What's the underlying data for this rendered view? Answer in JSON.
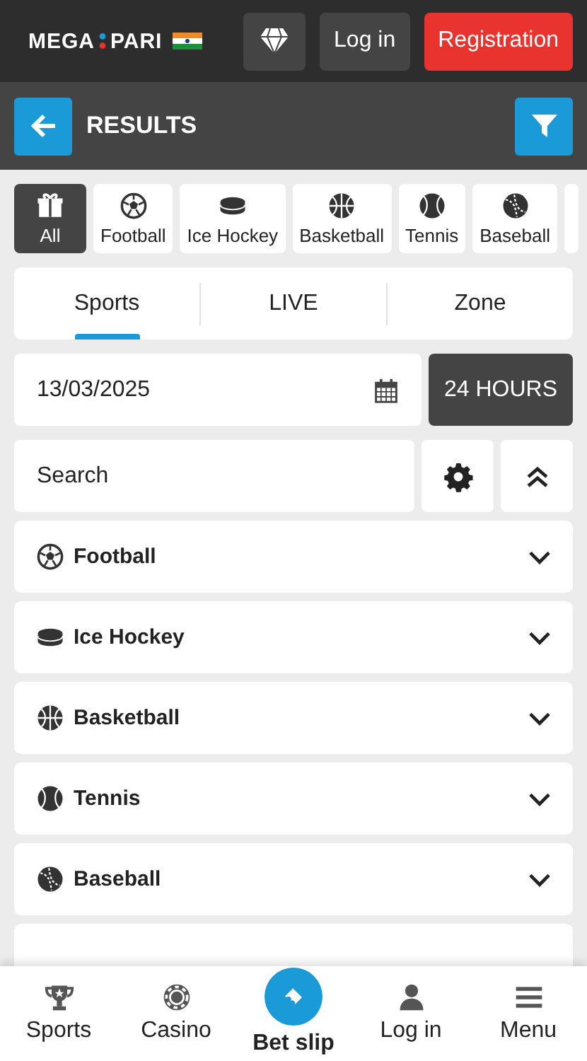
{
  "header": {
    "logo": {
      "left": "MEGA",
      "right": "PARI"
    },
    "login": "Log in",
    "register": "Registration"
  },
  "title": "RESULTS",
  "sport_chips": [
    {
      "label": "All",
      "kind": "gift",
      "selected": true
    },
    {
      "label": "Football",
      "kind": "football",
      "selected": false
    },
    {
      "label": "Ice Hockey",
      "kind": "hockey",
      "selected": false
    },
    {
      "label": "Basketball",
      "kind": "basketball",
      "selected": false
    },
    {
      "label": "Tennis",
      "kind": "tennis",
      "selected": false
    },
    {
      "label": "Baseball",
      "kind": "baseball",
      "selected": false
    }
  ],
  "tabs": [
    {
      "label": "Sports",
      "selected": true
    },
    {
      "label": "LIVE",
      "selected": false
    },
    {
      "label": "Zone",
      "selected": false
    }
  ],
  "date": {
    "value": "13/03/2025",
    "period": "24 HOURS"
  },
  "search": {
    "placeholder": "Search"
  },
  "sports": [
    {
      "name": "Football",
      "kind": "football"
    },
    {
      "name": "Ice Hockey",
      "kind": "hockey"
    },
    {
      "name": "Basketball",
      "kind": "basketball"
    },
    {
      "name": "Tennis",
      "kind": "tennis"
    },
    {
      "name": "Baseball",
      "kind": "baseball"
    }
  ],
  "bottom_nav": [
    {
      "label": "Sports",
      "kind": "trophy"
    },
    {
      "label": "Casino",
      "kind": "chip"
    },
    {
      "label": "Bet slip",
      "kind": "ticket"
    },
    {
      "label": "Log in",
      "kind": "person"
    },
    {
      "label": "Menu",
      "kind": "menu"
    }
  ]
}
